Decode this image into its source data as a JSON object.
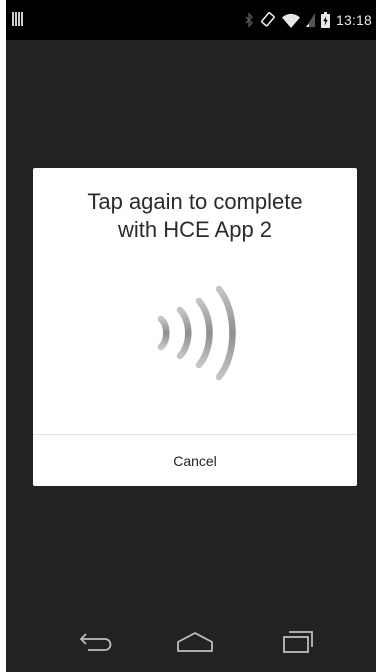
{
  "status_bar": {
    "time": "13:18",
    "icons": [
      "notification-icon",
      "bluetooth-icon",
      "rotation-lock-icon",
      "wifi-icon",
      "signal-icon",
      "battery-charging-icon"
    ]
  },
  "dialog": {
    "title_line1": "Tap again to complete",
    "title_line2": "with HCE App 2",
    "icon": "nfc-icon",
    "cancel_label": "Cancel"
  },
  "navigation_bar": {
    "buttons": [
      "back-icon",
      "home-icon",
      "recents-icon"
    ]
  },
  "colors": {
    "screen_background": "#222222",
    "status_bar": "#000000",
    "dialog_background": "#ffffff",
    "nfc_wave_gray": "#a0a0a0"
  }
}
